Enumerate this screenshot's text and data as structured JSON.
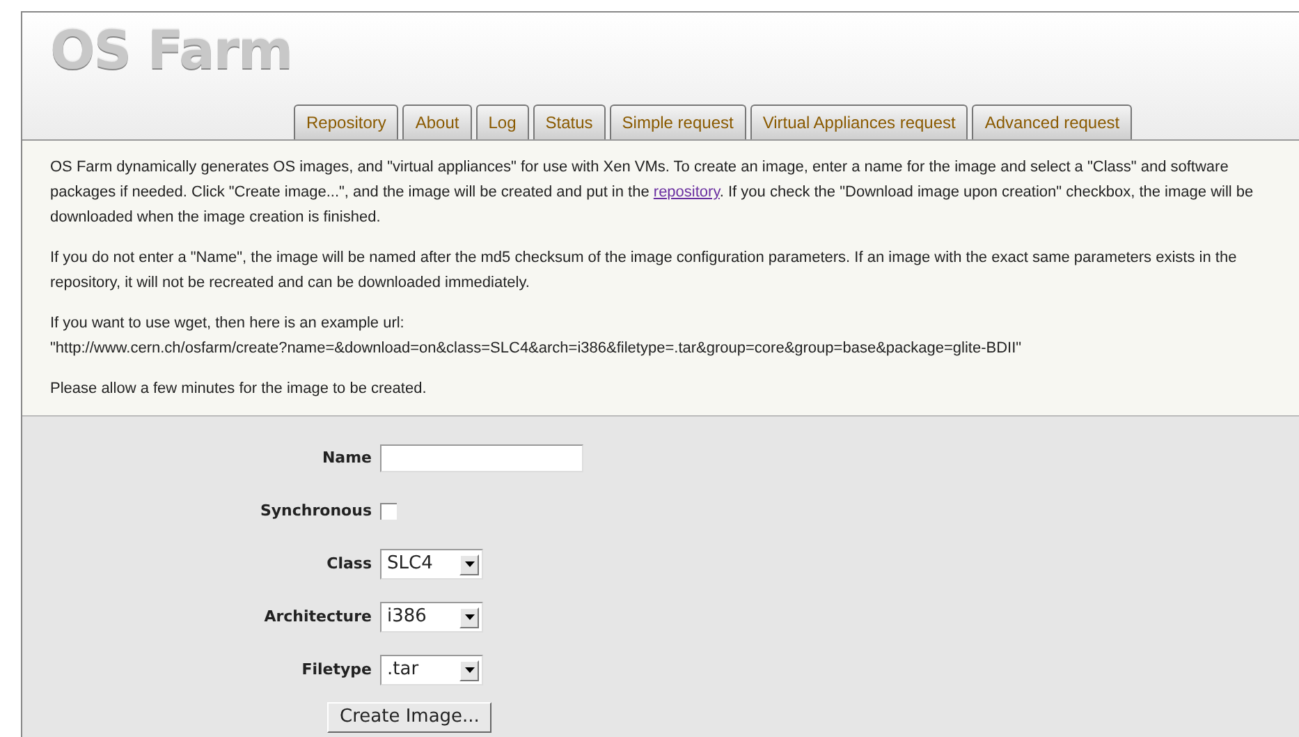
{
  "logo": {
    "text": "OS Farm"
  },
  "tabs": [
    {
      "label": "Repository",
      "selected": false
    },
    {
      "label": "About",
      "selected": false
    },
    {
      "label": "Log",
      "selected": false
    },
    {
      "label": "Status",
      "selected": false
    },
    {
      "label": "Simple request",
      "selected": false
    },
    {
      "label": "Virtual Appliances request",
      "selected": false
    },
    {
      "label": "Advanced request",
      "selected": false
    }
  ],
  "intro": {
    "before": "OS Farm dynamically generates OS images, and \"virtual appliances\" for use with Xen VMs. To create an image, enter a name for the image and select a \"Class\" and software packages if needed. Click \"Create image...\", and the image will be created and put in the ",
    "link": "repository",
    "after": ". If you check the \"Download image upon creation\" checkbox, the image will be downloaded when the image creation is finished."
  },
  "paragraphs": [
    "If you do not enter a \"Name\", the image will be named after the md5 checksum of the image configuration parameters. If an image with the exact same parameters exists in the repository, it will not be recreated and can be downloaded immediately.",
    "If you want to use wget, then here is an example url:",
    "\"http://www.cern.ch/osfarm/create?name=&download=on&class=SLC4&arch=i386&filetype=.tar&group=core&group=base&package=glite-BDII\"",
    "Please allow a few minutes for the image to be created."
  ],
  "form": {
    "fields": [
      {
        "kind": "text",
        "label": "Name"
      },
      {
        "kind": "checkbox",
        "label": "Synchronous",
        "checked": false
      },
      {
        "kind": "select",
        "label": "Class",
        "value": "SLC4"
      },
      {
        "kind": "select",
        "label": "Architecture",
        "value": "i386"
      },
      {
        "kind": "select",
        "label": "Filetype",
        "value": ".tar"
      }
    ],
    "submit": "Create Image..."
  }
}
